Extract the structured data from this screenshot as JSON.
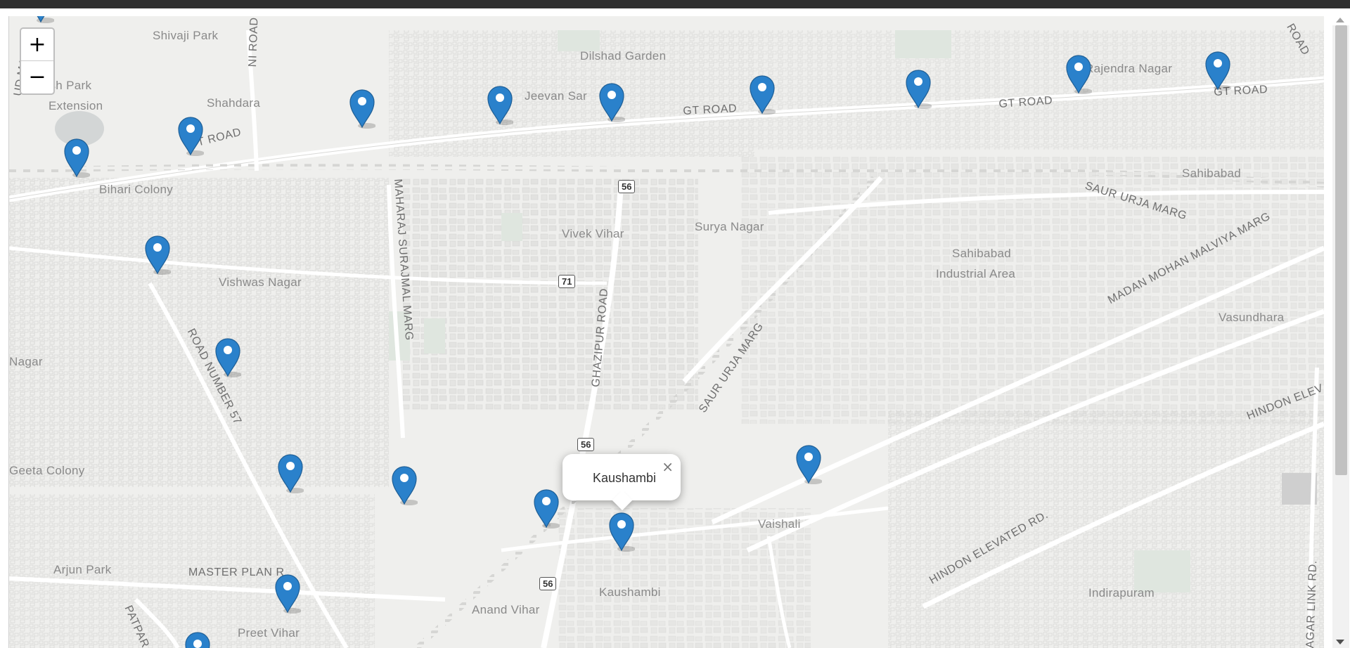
{
  "zoom": {
    "in_label": "+",
    "out_label": "−"
  },
  "popup": {
    "title": "Kaushambi",
    "close_label": "×"
  },
  "marker_color": "#2a81cb",
  "labels": {
    "shivaji_park": "Shivaji Park",
    "dilshad_garden": "Dilshad Garden",
    "rajendra_nagar": "Rajendra Nagar",
    "subash_park": "bash Park",
    "extension": "Extension",
    "shahdara": "Shahdara",
    "jeevan_sar": "Jeevan Sar",
    "bihari_colony": "Bihari Colony",
    "vivek_vihar": "Vivek Vihar",
    "surya_nagar": "Surya Nagar",
    "sahibabad": "Sahibabad",
    "sahibabad_ia": "Sahibabad",
    "industrial_area": "Industrial Area",
    "vishwas_nagar": "Vishwas Nagar",
    "nagar": "Nagar",
    "vasundhara": "Vasundhara",
    "geeta_colony": "Geeta Colony",
    "vaishali": "Vaishali",
    "arjun_park": "Arjun Park",
    "kaushambi": "Kaushambi",
    "indirapuram": "Indirapuram",
    "anand_vihar": "Anand Vihar",
    "preet_vihar": "Preet Vihar"
  },
  "roads": {
    "gt_road_1": "GT ROAD",
    "gt_road_2": "GT ROAD",
    "gt_road_3": "GT ROAD",
    "gt_road_west": "T ROAD",
    "saur_urja_1": "SAUR URJA MARG",
    "saur_urja_2": "SAUR URJA MARG",
    "madan_mohan": "MADAN MOHAN MALVIYA MARG",
    "maharaj_surajmal": "MAHARAJ SURAJMAL MARG",
    "ghazipur": "GHAZIPUR ROAD",
    "road_57": "ROAD NUMBER 57",
    "hindon_elevated": "HINDON ELEVATED RD.",
    "hindon_elev_right": "HINDON ELEV",
    "master_plan": "MASTER PLAN R",
    "patpar": "PATPAR",
    "nagar_link": "AGAR LINK RD.",
    "ni_road": "NI ROAD",
    "road_ne": "ROAD",
    "ud_ma": "UD MA"
  },
  "shields": {
    "s56a": "56",
    "s71": "71",
    "s56b": "56",
    "s56c": "56"
  }
}
